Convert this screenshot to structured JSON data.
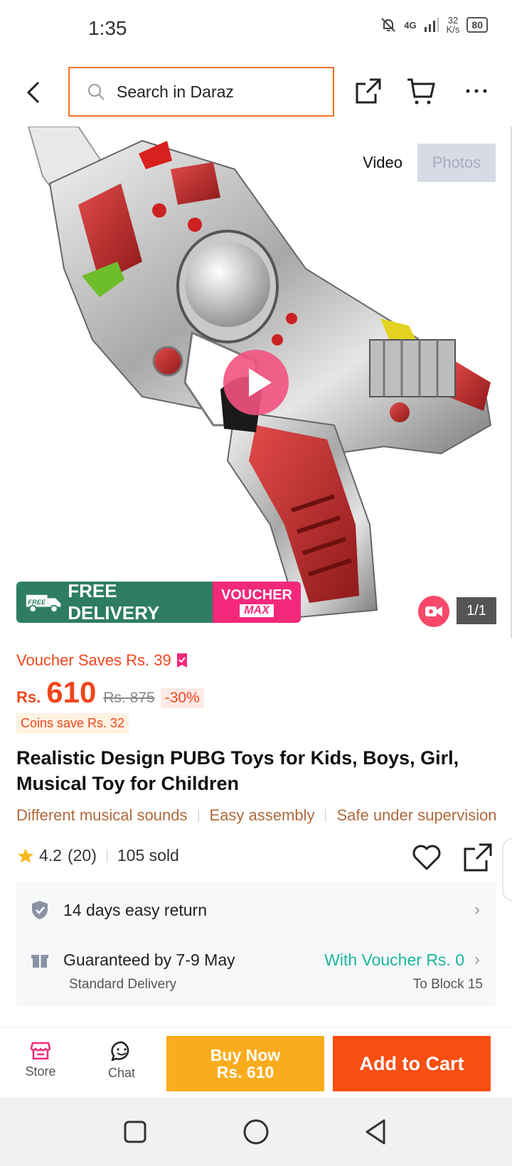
{
  "status": {
    "time": "1:35",
    "network": "4G",
    "speed_value": "32",
    "speed_unit": "K/s",
    "battery": "80"
  },
  "header": {
    "search_placeholder": "Search in Daraz"
  },
  "gallery": {
    "toggle_video": "Video",
    "toggle_photos": "Photos",
    "counter": "1/1",
    "promo_free_tag": "FREE",
    "promo_free_delivery": "FREE DELIVERY",
    "promo_voucher": "VOUCHER",
    "promo_max": "MAX"
  },
  "pricing": {
    "voucher_saves": "Voucher Saves Rs. 39",
    "currency": "Rs.",
    "price": "610",
    "original_price": "Rs. 875",
    "discount": "-30%",
    "coins_save": "Coins save Rs. 32"
  },
  "product": {
    "title": "Realistic Design PUBG Toys for Kids, Boys, Girl, Musical Toy for Children",
    "features": [
      "Different musical sounds",
      "Easy assembly",
      "Safe under supervision"
    ],
    "rating": "4.2",
    "rating_count": "(20)",
    "sold": "105 sold"
  },
  "service": {
    "return_text": "14 days easy return",
    "delivery_text": "Guaranteed by 7-9 May",
    "voucher_text": "With Voucher Rs. 0",
    "delivery_type": "Standard Delivery",
    "location": "To Block 15"
  },
  "bottom_bar": {
    "store_label": "Store",
    "chat_label": "Chat",
    "buy_now_label": "Buy Now",
    "buy_now_price": "Rs. 610",
    "add_to_cart_label": "Add to Cart"
  },
  "colors": {
    "accent": "#f57224",
    "price": "#f0461c",
    "buy_now": "#fbac1c",
    "add_cart": "#f94e12",
    "voucher_green": "#1cb49a",
    "promo_green": "#2e7d62",
    "promo_pink": "#f3287b"
  },
  "icons": [
    "back-icon",
    "search-icon",
    "share-icon",
    "cart-icon",
    "more-icon",
    "play-icon",
    "truck-icon",
    "video-camera-icon",
    "voucher-tag-icon",
    "star-icon",
    "heart-icon",
    "shield-check-icon",
    "gift-box-icon",
    "chevron-right-icon",
    "store-icon",
    "chat-icon",
    "square-nav-icon",
    "circle-nav-icon",
    "triangle-back-icon"
  ]
}
